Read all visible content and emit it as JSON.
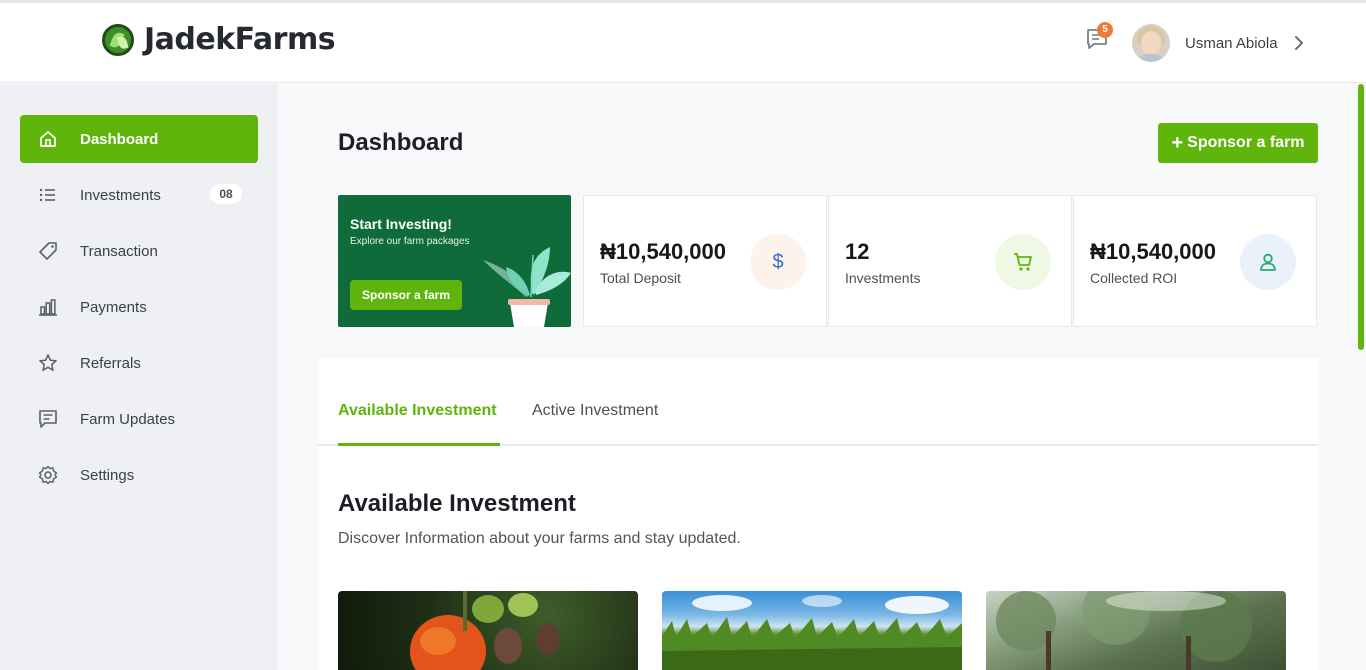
{
  "app": {
    "brand": "JadekFarms",
    "notification_count": "5",
    "user_name": "Usman Abiola"
  },
  "sidebar": {
    "items": [
      {
        "label": "Dashboard",
        "icon": "home-icon",
        "active": true
      },
      {
        "label": "Investments",
        "icon": "list-icon",
        "badge": "08"
      },
      {
        "label": "Transaction",
        "icon": "tag-icon"
      },
      {
        "label": "Payments",
        "icon": "bar-chart-icon"
      },
      {
        "label": "Referrals",
        "icon": "star-icon"
      },
      {
        "label": "Farm Updates",
        "icon": "message-square-icon"
      },
      {
        "label": "Settings",
        "icon": "gear-icon"
      }
    ]
  },
  "main": {
    "title": "Dashboard",
    "sponsor_button": "Sponsor a farm",
    "promo": {
      "title": "Start Investing!",
      "subtitle": "Explore our farm packages",
      "button": "Sponsor a farm"
    },
    "stats": [
      {
        "value": "₦10,540,000",
        "label": "Total Deposit",
        "icon": "dollar-icon",
        "icon_bg": "#fdf3ea",
        "icon_color": "#2f6fd6"
      },
      {
        "value": "12",
        "label": "Investments",
        "icon": "cart-icon",
        "icon_bg": "#eef8e2",
        "icon_color": "#5fb50b"
      },
      {
        "value": "₦10,540,000",
        "label": "Collected ROI",
        "icon": "user-icon",
        "icon_bg": "#eaf1fb",
        "icon_color": "#1fae76"
      }
    ],
    "tabs": [
      {
        "label": "Available Investment",
        "active": true
      },
      {
        "label": "Active Investment",
        "active": false
      }
    ],
    "section": {
      "title": "Available Investment",
      "subtitle": "Discover Information about your farms and stay updated."
    }
  },
  "colors": {
    "accent": "#5fb50b",
    "promo_bg": "#0f6b3a",
    "badge": "#ec7a3b"
  }
}
